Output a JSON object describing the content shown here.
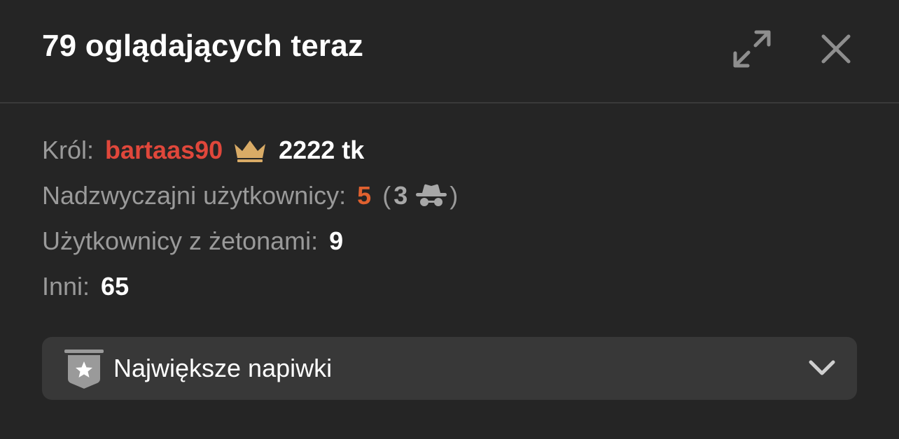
{
  "header": {
    "title": "79 oglądających teraz",
    "icons": [
      "expand-icon",
      "close-icon"
    ]
  },
  "stats": {
    "king_label": "Król:",
    "king_name": "bartaas90",
    "king_tokens": "2222 tk",
    "special_label": "Nadzwyczajni użytkownicy:",
    "special_count": "5",
    "paren_open": "(",
    "anon_count": "3",
    "paren_close": ")",
    "token_users_label": "Użytkownicy z żetonami:",
    "token_users_count": "9",
    "others_label": "Inni:",
    "others_count": "65"
  },
  "tips": {
    "label": "Największe napiwki",
    "icons": [
      "star-badge-icon",
      "chevron-down-icon"
    ]
  },
  "colors": {
    "background": "#252525",
    "king_name": "#e0473b",
    "special_count": "#e0612f",
    "crown": "#d9ab66",
    "muted_text": "#9a9a9a",
    "panel": "#383838"
  }
}
